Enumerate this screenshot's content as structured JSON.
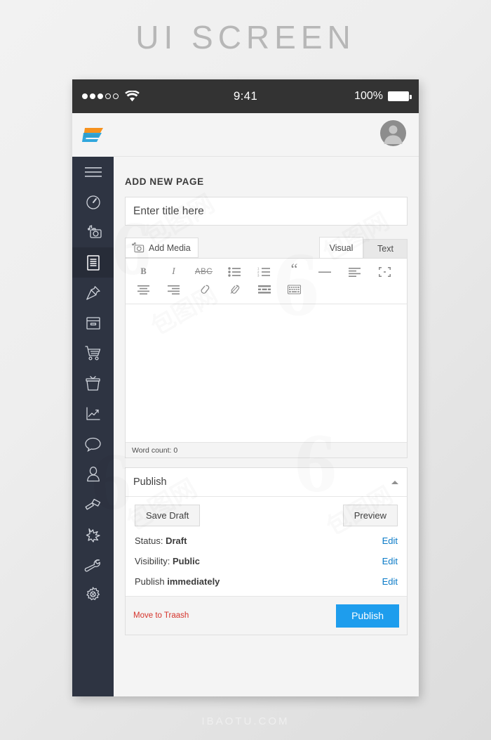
{
  "poster": {
    "title": "UI SCREEN",
    "footer_brand": "IBAOTU.COM"
  },
  "statusbar": {
    "signal_filled": 3,
    "signal_hollow": 2,
    "wifi_icon": "wifi-icon",
    "time": "9:41",
    "battery_percent": "100%",
    "battery_icon": "battery-full-icon"
  },
  "header": {
    "logo_alt": "app-logo",
    "avatar_alt": "user-avatar"
  },
  "sidebar": {
    "items": [
      {
        "icon": "hamburger-menu-icon",
        "name": "menu-toggle",
        "active": false
      },
      {
        "icon": "dashboard-gauge-icon",
        "name": "dashboard",
        "active": false
      },
      {
        "icon": "media-camera-icon",
        "name": "media",
        "active": false
      },
      {
        "icon": "pages-document-icon",
        "name": "pages",
        "active": true
      },
      {
        "icon": "pin-icon",
        "name": "posts",
        "active": false
      },
      {
        "icon": "archive-box-icon",
        "name": "archive",
        "active": false
      },
      {
        "icon": "shopping-cart-icon",
        "name": "shop",
        "active": false
      },
      {
        "icon": "gift-basket-icon",
        "name": "products",
        "active": false
      },
      {
        "icon": "analytics-chart-icon",
        "name": "analytics",
        "active": false
      },
      {
        "icon": "comment-bubble-icon",
        "name": "comments",
        "active": false
      },
      {
        "icon": "user-profile-icon",
        "name": "users",
        "active": false
      },
      {
        "icon": "paint-brush-icon",
        "name": "appearance",
        "active": false
      },
      {
        "icon": "plugin-plug-icon",
        "name": "plugins",
        "active": false
      },
      {
        "icon": "wrench-tools-icon",
        "name": "tools",
        "active": false
      },
      {
        "icon": "gear-settings-icon",
        "name": "settings",
        "active": false
      }
    ]
  },
  "main": {
    "section_heading": "ADD NEW PAGE",
    "title_placeholder": "Enter title here",
    "add_media_label": "Add Media",
    "add_media_icon": "add-media-icon",
    "tabs": [
      {
        "label": "Visual",
        "active": true
      },
      {
        "label": "Text",
        "active": false
      }
    ],
    "toolbar_row1": [
      {
        "label": "B",
        "name": "bold-icon",
        "kind": "bold"
      },
      {
        "label": "I",
        "name": "italic-icon",
        "kind": "italic"
      },
      {
        "label": "ABC",
        "name": "strikethrough-icon",
        "kind": "abc"
      },
      {
        "label": "",
        "name": "bulleted-list-icon",
        "kind": "ul"
      },
      {
        "label": "",
        "name": "numbered-list-icon",
        "kind": "ol"
      },
      {
        "label": "“",
        "name": "blockquote-icon",
        "kind": "quote"
      },
      {
        "label": "",
        "name": "horizontal-rule-icon",
        "kind": "hr"
      },
      {
        "label": "",
        "name": "align-left-icon",
        "kind": "alignleft"
      },
      {
        "label": "",
        "name": "fullscreen-icon",
        "kind": "fullscreen"
      }
    ],
    "toolbar_row2": [
      {
        "label": "",
        "name": "align-center-icon",
        "kind": "aligncenter"
      },
      {
        "label": "",
        "name": "align-right-icon",
        "kind": "alignright"
      },
      {
        "label": "",
        "name": "insert-link-icon",
        "kind": "link"
      },
      {
        "label": "",
        "name": "unlink-icon",
        "kind": "unlink"
      },
      {
        "label": "",
        "name": "read-more-icon",
        "kind": "more"
      },
      {
        "label": "",
        "name": "keyboard-shortcuts-icon",
        "kind": "keyboard"
      }
    ],
    "editor_content": "",
    "word_count_label": "Word count: 0"
  },
  "publish": {
    "panel_title": "Publish",
    "collapse_icon": "chevron-up-icon",
    "save_draft_label": "Save Draft",
    "preview_label": "Preview",
    "rows": [
      {
        "label": "Status:",
        "value": "Draft",
        "action": "Edit"
      },
      {
        "label": "Visibility:",
        "value": "Public",
        "action": "Edit"
      },
      {
        "label": "Publish",
        "value": "immediately",
        "action": "Edit"
      }
    ],
    "trash_label": "Move to Traash",
    "publish_label": "Publish",
    "publish_color": "#1e9ded",
    "trash_color": "#d5342c",
    "edit_link_color": "#0a7ac7"
  },
  "watermarks": [
    "6",
    "包图网",
    "6",
    "包图网"
  ]
}
